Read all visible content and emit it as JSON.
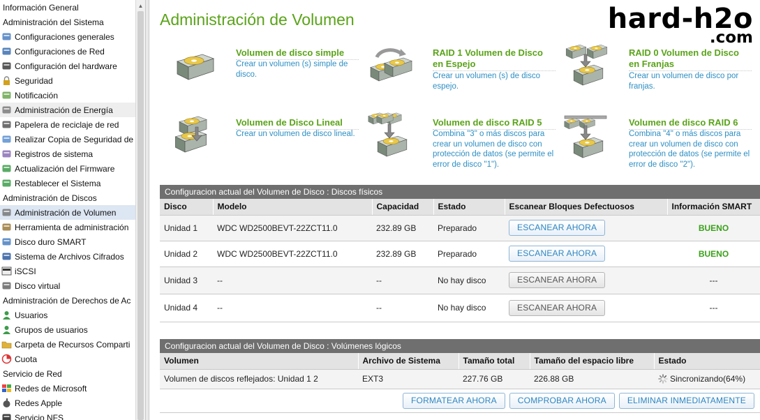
{
  "sidebar": {
    "items": [
      {
        "label": "Información General",
        "type": "section"
      },
      {
        "label": "Administración del Sistema",
        "type": "section"
      },
      {
        "label": "Configuraciones generales",
        "type": "leaf",
        "icon": "monitor-icon"
      },
      {
        "label": "Configuraciones de Red",
        "type": "leaf",
        "icon": "network-icon"
      },
      {
        "label": "Configuración del hardware",
        "type": "leaf",
        "icon": "hardware-chip-icon"
      },
      {
        "label": "Seguridad",
        "type": "leaf",
        "icon": "security-lock-icon"
      },
      {
        "label": "Notificación",
        "type": "leaf",
        "icon": "notification-icon"
      },
      {
        "label": "Administración de Energía",
        "type": "leaf",
        "icon": "power-icon",
        "state": "hover"
      },
      {
        "label": "Papelera de reciclaje de red",
        "type": "leaf",
        "icon": "recycle-bin-icon"
      },
      {
        "label": "Realizar Copia de Seguridad de",
        "type": "leaf",
        "icon": "backup-icon"
      },
      {
        "label": "Registros de sistema",
        "type": "leaf",
        "icon": "system-log-icon"
      },
      {
        "label": "Actualización del Firmware",
        "type": "leaf",
        "icon": "firmware-update-icon"
      },
      {
        "label": "Restablecer el Sistema",
        "type": "leaf",
        "icon": "reset-icon"
      },
      {
        "label": "Administración de Discos",
        "type": "section"
      },
      {
        "label": "Administración de Volumen",
        "type": "leaf",
        "icon": "volume-disk-icon",
        "state": "active"
      },
      {
        "label": "Herramienta de administración",
        "type": "leaf",
        "icon": "admin-tool-icon"
      },
      {
        "label": "Disco duro SMART",
        "type": "leaf",
        "icon": "smart-disk-icon"
      },
      {
        "label": "Sistema de Archivos Cifrados",
        "type": "leaf",
        "icon": "encrypted-fs-icon"
      },
      {
        "label": "iSCSI",
        "type": "leaf",
        "icon": "iscsi-icon"
      },
      {
        "label": "Disco virtual",
        "type": "leaf",
        "icon": "virtual-disk-icon"
      },
      {
        "label": "Administración de Derechos de Ac",
        "type": "section"
      },
      {
        "label": "Usuarios",
        "type": "leaf",
        "icon": "user-icon"
      },
      {
        "label": "Grupos de usuarios",
        "type": "leaf",
        "icon": "user-group-icon"
      },
      {
        "label": "Carpeta de Recursos Comparti",
        "type": "leaf",
        "icon": "shared-folder-icon"
      },
      {
        "label": "Cuota",
        "type": "leaf",
        "icon": "quota-icon"
      },
      {
        "label": "Servicio de Red",
        "type": "section"
      },
      {
        "label": "Redes de Microsoft",
        "type": "leaf",
        "icon": "windows-icon"
      },
      {
        "label": "Redes Apple",
        "type": "leaf",
        "icon": "apple-icon"
      },
      {
        "label": "Servicio NFS",
        "type": "leaf",
        "icon": "nfs-icon"
      }
    ]
  },
  "main": {
    "title": "Administración de Volumen",
    "brand": {
      "name": "hard-h2o",
      "tld": ".com"
    },
    "options": [
      {
        "title": "Volumen de disco simple",
        "desc": [
          "Crear un volumen (s) simple de",
          "disco."
        ],
        "icon": "single-disk-icon"
      },
      {
        "title": "RAID 1 Volumen de Disco en Espejo",
        "desc": [
          "Crear un volumen (s) de disco",
          "espejo."
        ],
        "icon": "raid1-mirror-icon"
      },
      {
        "title": "RAID 0 Volumen de Disco en Franjas",
        "desc": [
          "Crear un volumen de disco por",
          "franjas."
        ],
        "icon": "raid0-stripe-icon"
      },
      {
        "title": "Volumen de Disco Lineal",
        "desc": [
          "Crear un volumen de disco lineal."
        ],
        "icon": "linear-disk-icon"
      },
      {
        "title": "Volumen de disco RAID 5",
        "desc": [
          "Combina \"3\" o más discos para",
          "crear un volumen de disco con",
          "protección de datos (se permite el",
          "error de disco \"1\")."
        ],
        "icon": "raid5-icon"
      },
      {
        "title": "Volumen de disco RAID 6",
        "desc": [
          "Combina \"4\" o más discos para",
          "crear un volumen de disco con",
          "protección de datos (se permite el",
          "error de disco \"2\")."
        ],
        "icon": "raid6-icon"
      }
    ],
    "physical": {
      "header": "Configuracion actual del Volumen de Disco : Discos físicos",
      "columns": [
        "Disco",
        "Modelo",
        "Capacidad",
        "Estado",
        "Escanear Bloques Defectuosos",
        "Información SMART"
      ],
      "rows": [
        {
          "disk": "Unidad 1",
          "model": "WDC WD2500BEVT-22ZCT11.0",
          "capacity": "232.89 GB",
          "status": "Preparado",
          "scan": "ESCANEAR AHORA",
          "scan_enabled": true,
          "smart": "BUENO"
        },
        {
          "disk": "Unidad 2",
          "model": "WDC WD2500BEVT-22ZCT11.0",
          "capacity": "232.89 GB",
          "status": "Preparado",
          "scan": "ESCANEAR AHORA",
          "scan_enabled": true,
          "smart": "BUENO"
        },
        {
          "disk": "Unidad 3",
          "model": "--",
          "capacity": "--",
          "status": "No hay disco",
          "scan": "ESCANEAR AHORA",
          "scan_enabled": false,
          "smart": "---"
        },
        {
          "disk": "Unidad 4",
          "model": "--",
          "capacity": "--",
          "status": "No hay disco",
          "scan": "ESCANEAR AHORA",
          "scan_enabled": false,
          "smart": "---"
        }
      ]
    },
    "logical": {
      "header": "Configuracion actual del Volumen de Disco : Volúmenes lógicos",
      "columns": [
        "Volumen",
        "Archivo de Sistema",
        "Tamaño total",
        "Tamaño del espacio libre",
        "Estado"
      ],
      "rows": [
        {
          "volume": "Volumen de discos reflejados: Unidad 1 2",
          "fs": "EXT3",
          "total": "227.76 GB",
          "free": "226.88 GB",
          "status": "Sincronizando(64%)"
        }
      ],
      "actions": [
        "FORMATEAR AHORA",
        "COMPROBAR AHORA",
        "ELIMINAR INMEDIATAMENTE"
      ]
    }
  }
}
